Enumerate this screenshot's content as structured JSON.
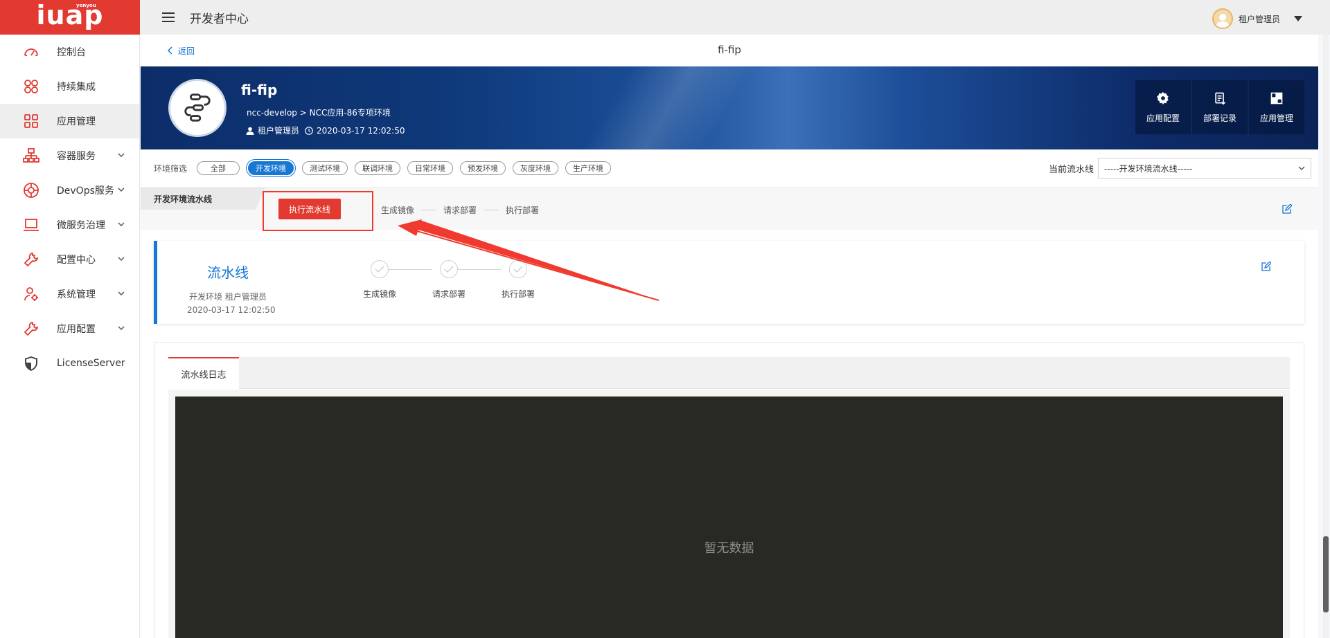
{
  "logo": {
    "text": "iuap",
    "sub": "yonyou"
  },
  "sidebar": {
    "items": [
      {
        "label": "控制台"
      },
      {
        "label": "持续集成"
      },
      {
        "label": "应用管理"
      },
      {
        "label": "容器服务"
      },
      {
        "label": "DevOps服务"
      },
      {
        "label": "微服务治理"
      },
      {
        "label": "配置中心"
      },
      {
        "label": "系统管理"
      },
      {
        "label": "应用配置"
      },
      {
        "label": "LicenseServer"
      }
    ]
  },
  "header": {
    "title": "开发者中心",
    "user_name": "租户管理员"
  },
  "backbar": {
    "back_label": "返回",
    "page_title": "fi-fip"
  },
  "app": {
    "name": "fi-fip",
    "path": "ncc-develop  >  NCC应用-86专项环境",
    "owner": "租户管理员",
    "time": "2020-03-17 12:02:50",
    "actions": [
      "应用配置",
      "部署记录",
      "应用管理"
    ]
  },
  "env_filter": {
    "label": "环境筛选",
    "chips": [
      "全部",
      "开发环境",
      "测试环境",
      "联调环境",
      "日常环境",
      "预发环境",
      "灰度环境",
      "生产环境"
    ],
    "active": "开发环境",
    "pipeline_label": "当前流水线",
    "pipeline_value": "-----开发环境流水线-----"
  },
  "pipeline_strip": {
    "tab": "开发环境流水线",
    "run_button": "执行流水线",
    "steps": [
      "生成镜像",
      "请求部署",
      "执行部署"
    ]
  },
  "pipeline_card": {
    "title": "流水线",
    "sub": "开发环境 租户管理员",
    "date": "2020-03-17 12:02:50",
    "steps": [
      "生成镜像",
      "请求部署",
      "执行部署"
    ]
  },
  "log": {
    "tab": "流水线日志",
    "empty": "暂无数据"
  },
  "colors": {
    "brand": "#e23a31",
    "accent": "#1677d4",
    "terminal": "#282923"
  },
  "icons": [
    "dashboard-icon",
    "ci-icon",
    "apps-grid-icon",
    "container-icon",
    "devops-icon",
    "laptop-icon",
    "wrench-icon",
    "user-gear-icon",
    "wrench-icon",
    "shield-icon"
  ]
}
